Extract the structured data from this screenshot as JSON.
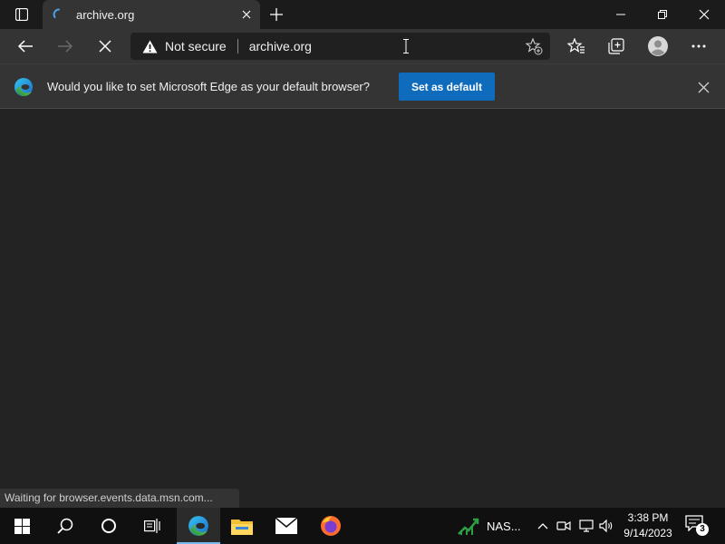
{
  "browser": {
    "tab": {
      "title": "archive.org"
    },
    "address": {
      "security_label": "Not secure",
      "url": "archive.org"
    },
    "infobar": {
      "message": "Would you like to set Microsoft Edge as your default browser?",
      "button_label": "Set as default"
    },
    "status_text": "Waiting for browser.events.data.msn.com..."
  },
  "taskbar": {
    "stock_label": "NAS...",
    "clock": {
      "time": "3:38 PM",
      "date": "9/14/2023"
    },
    "notification_count": "3"
  },
  "colors": {
    "accent": "#0f6cbd",
    "taskbar_active": "#76b9ed"
  }
}
